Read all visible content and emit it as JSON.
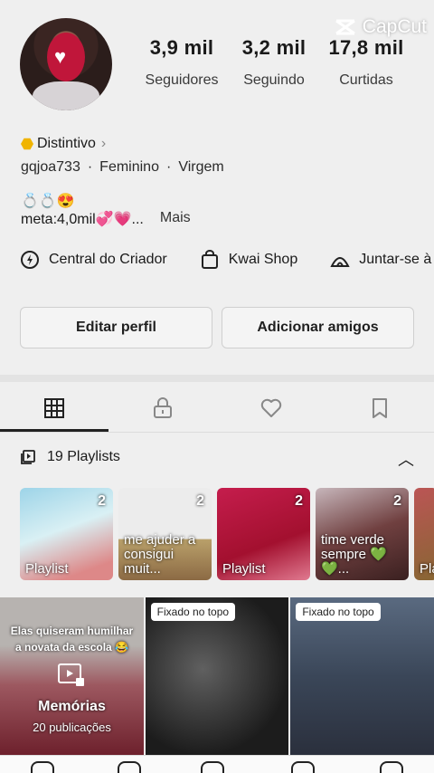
{
  "watermark": {
    "label": "CapCut"
  },
  "profile": {
    "stats": [
      {
        "value": "3,9 mil",
        "label": "Seguidores"
      },
      {
        "value": "3,2 mil",
        "label": "Seguindo"
      },
      {
        "value": "17,8 mil",
        "label": "Curtidas"
      }
    ],
    "badge_label": "Distintivo",
    "username": "gqjoa733",
    "gender": "Feminino",
    "sign": "Virgem",
    "separator": "·",
    "emoji_line": "💍💍😍",
    "bio": "meta:4,0mil💞💗...",
    "more_label": "Mais"
  },
  "creator_links": [
    {
      "label": "Central do Criador",
      "icon": "lightning-circle-icon"
    },
    {
      "label": "Kwai Shop",
      "icon": "shopping-bag-icon"
    },
    {
      "label": "Juntar-se à",
      "icon": "tent-icon"
    }
  ],
  "actions": {
    "edit_label": "Editar perfil",
    "add_label": "Adicionar amigos"
  },
  "tabs": [
    {
      "name": "grid-icon",
      "active": true
    },
    {
      "name": "lock-icon",
      "active": false
    },
    {
      "name": "heart-icon",
      "active": false
    },
    {
      "name": "bookmark-icon",
      "active": false
    }
  ],
  "playlists": {
    "header": "19 Playlists",
    "items": [
      {
        "count": "2",
        "title": "Playlist"
      },
      {
        "count": "2",
        "title": "me ajuder a consigui muit..."
      },
      {
        "count": "2",
        "title": "Playlist"
      },
      {
        "count": "2",
        "title": "time verde sempre 💚💚..."
      },
      {
        "count": "",
        "title": "Pla"
      }
    ]
  },
  "grid_posts": [
    {
      "caption": "Elas quiseram humilhar a novata da escola 😂",
      "title": "Memórias",
      "subtitle": "20 publicações"
    },
    {
      "pin_label": "Fixado no topo"
    },
    {
      "pin_label": "Fixado no topo"
    }
  ],
  "colors": {
    "badge": "#f0b400",
    "background": "#efefef"
  }
}
